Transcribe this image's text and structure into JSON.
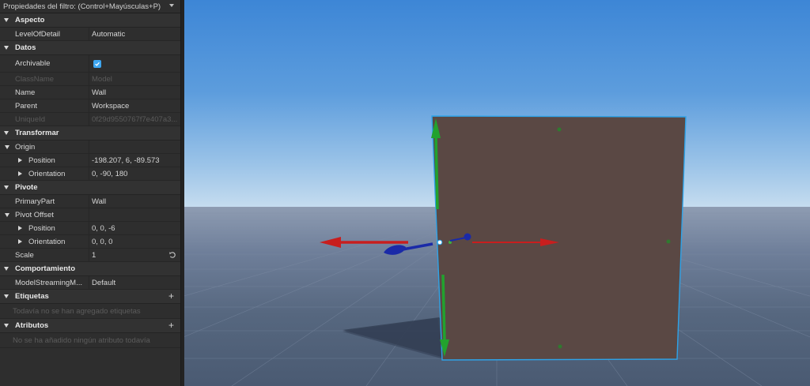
{
  "filter": {
    "label": "Propiedades del filtro: (Control+Mayúsculas+P)"
  },
  "sections": {
    "aspecto": {
      "title": "Aspecto"
    },
    "datos": {
      "title": "Datos"
    },
    "transformar": {
      "title": "Transformar"
    },
    "pivote": {
      "title": "Pivote"
    },
    "comportamiento": {
      "title": "Comportamiento"
    },
    "etiquetas": {
      "title": "Etiquetas",
      "empty": "Todavía no se han agregado etiquetas"
    },
    "atributos": {
      "title": "Atributos",
      "empty": "No se ha añadido ningún atributo todavía"
    }
  },
  "props": {
    "level_of_detail": {
      "name": "LevelOfDetail",
      "value": "Automatic"
    },
    "archivable": {
      "name": "Archivable",
      "checked": true
    },
    "class_name": {
      "name": "ClassName",
      "value": "Model"
    },
    "name": {
      "name": "Name",
      "value": "Wall"
    },
    "parent": {
      "name": "Parent",
      "value": "Workspace"
    },
    "unique_id": {
      "name": "UniqueId",
      "value": "0f29d9550767f7e407a3..."
    },
    "origin": {
      "name": "Origin"
    },
    "origin_position": {
      "name": "Position",
      "value": "-198.207, 6, -89.573"
    },
    "origin_orientation": {
      "name": "Orientation",
      "value": "0, -90, 180"
    },
    "primary_part": {
      "name": "PrimaryPart",
      "value": "Wall"
    },
    "pivot_offset": {
      "name": "Pivot Offset"
    },
    "pivot_position": {
      "name": "Position",
      "value": "0, 0, -6"
    },
    "pivot_orientation": {
      "name": "Orientation",
      "value": "0, 0, 0"
    },
    "scale": {
      "name": "Scale",
      "value": "1"
    },
    "model_streaming": {
      "name": "ModelStreamingM...",
      "value": "Default"
    }
  },
  "colors": {
    "accent": "#3ea6f0",
    "wall": "#5a4844",
    "selection": "#2ea3e8",
    "axis_x": "#c81e1e",
    "axis_y": "#22a22e",
    "axis_z": "#1a2aa8"
  },
  "icons": [
    "dropdown-arrow-icon",
    "collapse-arrow-icon",
    "expand-arrow-icon",
    "checkbox-checked-icon",
    "reset-icon",
    "plus-icon"
  ]
}
